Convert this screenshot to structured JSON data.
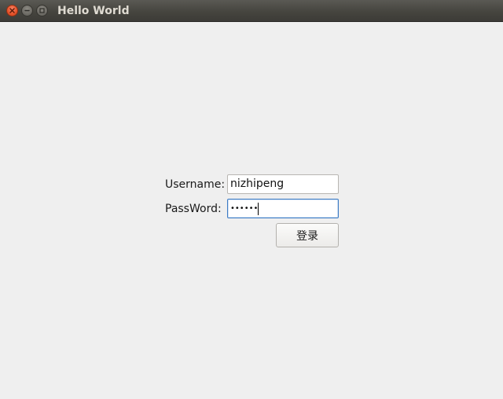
{
  "window": {
    "title": "Hello World"
  },
  "titlebar_buttons": {
    "close_icon": "close-icon",
    "minimize_icon": "minimize-icon",
    "maximize_icon": "maximize-icon"
  },
  "form": {
    "username_label": "Username:",
    "username_value": "nizhipeng",
    "password_label": "PassWord:",
    "password_masked": "••••••",
    "login_button_label": "登录"
  },
  "colors": {
    "close_button": "#e9552c",
    "focus_border": "#3d7bc4",
    "window_background": "#efefef",
    "titlebar": "#46453f"
  }
}
